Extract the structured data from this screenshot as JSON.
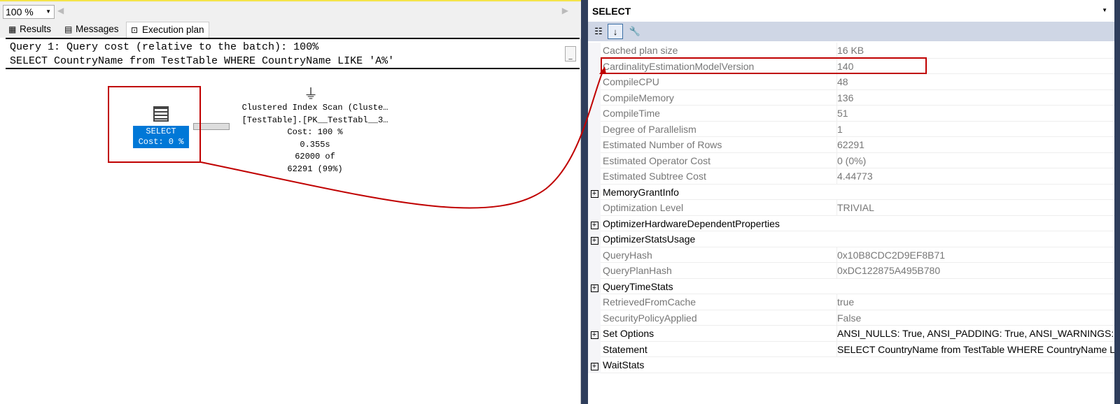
{
  "toolbar": {
    "zoom": "100 %"
  },
  "tabs": [
    {
      "label": "Results",
      "icon": "grid-icon"
    },
    {
      "label": "Messages",
      "icon": "messages-icon"
    },
    {
      "label": "Execution plan",
      "icon": "plan-icon",
      "active": true
    }
  ],
  "query": {
    "line1": "Query 1: Query cost (relative to the batch): 100%",
    "line2": "SELECT CountryName from TestTable WHERE CountryName LIKE 'A%'"
  },
  "plan": {
    "select_node": {
      "label": "SELECT",
      "cost": "Cost: 0 %"
    },
    "scan_node": {
      "line1": "Clustered Index Scan (Cluste…",
      "line2": "[TestTable].[PK__TestTabl__3…",
      "cost": "Cost: 100 %",
      "time": "0.355s",
      "rows1": "62000 of",
      "rows2": "62291 (99%)"
    }
  },
  "properties": {
    "title": "SELECT",
    "rows": [
      {
        "name": "Cached plan size",
        "value": "16 KB"
      },
      {
        "name": "CardinalityEstimationModelVersion",
        "value": "140"
      },
      {
        "name": "CompileCPU",
        "value": "48"
      },
      {
        "name": "CompileMemory",
        "value": "136"
      },
      {
        "name": "CompileTime",
        "value": "51"
      },
      {
        "name": "Degree of Parallelism",
        "value": "1"
      },
      {
        "name": "Estimated Number of Rows",
        "value": "62291"
      },
      {
        "name": "Estimated Operator Cost",
        "value": "0 (0%)"
      },
      {
        "name": "Estimated Subtree Cost",
        "value": "4.44773"
      },
      {
        "name": "MemoryGrantInfo",
        "value": "",
        "expandable": true
      },
      {
        "name": "Optimization Level",
        "value": "TRIVIAL"
      },
      {
        "name": "OptimizerHardwareDependentProperties",
        "value": "",
        "expandable": true
      },
      {
        "name": "OptimizerStatsUsage",
        "value": "",
        "expandable": true
      },
      {
        "name": "QueryHash",
        "value": "0x10B8CDC2D9EF8B71"
      },
      {
        "name": "QueryPlanHash",
        "value": "0xDC122875A495B780"
      },
      {
        "name": "QueryTimeStats",
        "value": "",
        "expandable": true
      },
      {
        "name": "RetrievedFromCache",
        "value": "true"
      },
      {
        "name": "SecurityPolicyApplied",
        "value": "False"
      },
      {
        "name": "Set Options",
        "value": "ANSI_NULLS: True, ANSI_PADDING: True, ANSI_WARNINGS: True",
        "expandable": true
      },
      {
        "name": "Statement",
        "value": "SELECT  CountryName  from TestTable  WHERE CountryName LIKE 'A%'",
        "dark": true
      },
      {
        "name": "WaitStats",
        "value": "",
        "expandable": true
      }
    ]
  },
  "colors": {
    "highlight": "#c00000",
    "selected_node": "#0078d7",
    "divider": "#2f3e5c"
  }
}
